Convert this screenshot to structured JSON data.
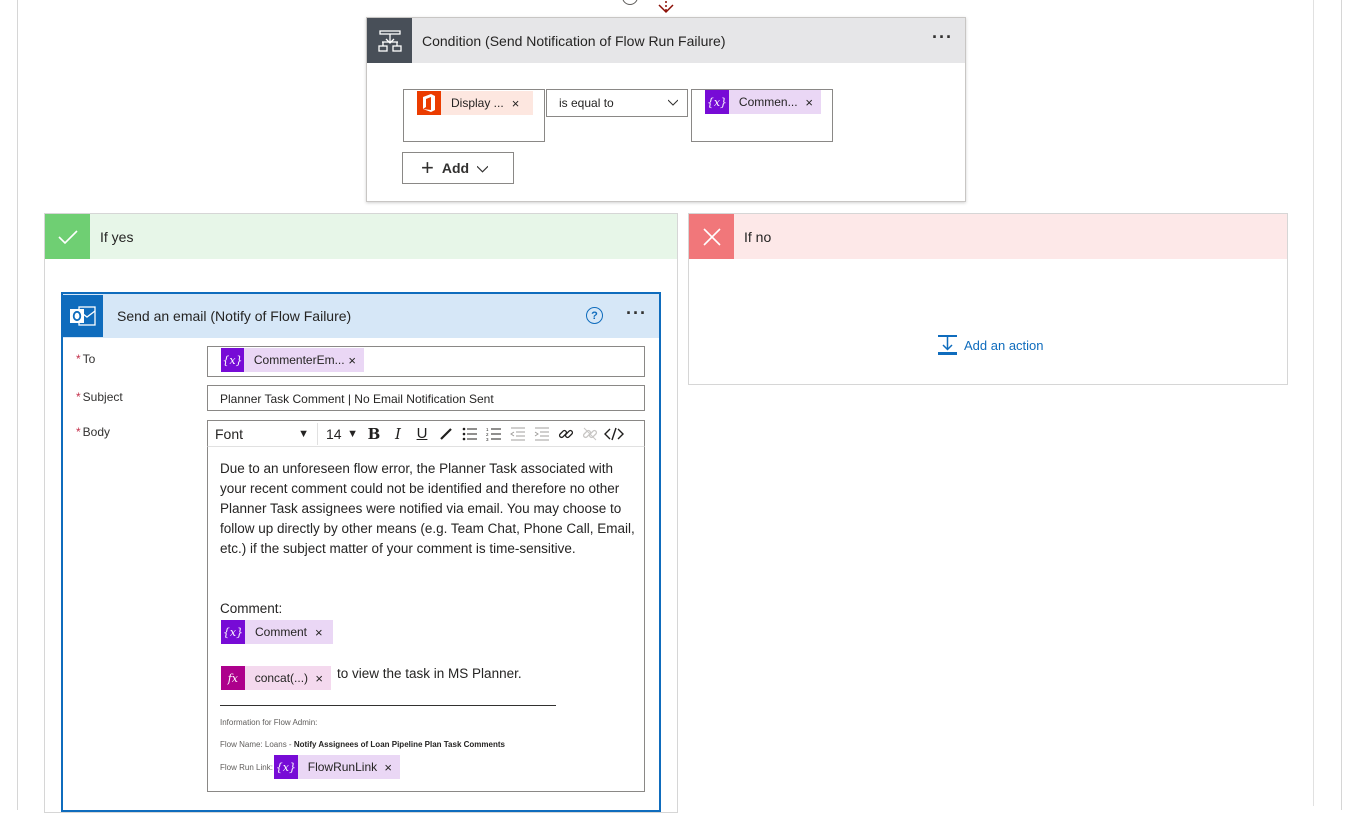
{
  "condition": {
    "title": "Condition (Send Notification of Flow Run Failure)",
    "left_token": "Display ...",
    "operator": "is equal to",
    "right_token": "Commen...",
    "add_label": "Add",
    "token_remove": "×"
  },
  "if_yes": {
    "title": "If yes"
  },
  "if_no": {
    "title": "If no",
    "add_action": "Add an action"
  },
  "email": {
    "title": "Send an email (Notify of Flow Failure)",
    "help": "?",
    "to_label": "To",
    "to_token": "CommenterEm...",
    "subject_label": "Subject",
    "subject_value": "Planner Task Comment | No Email Notification Sent",
    "body_label": "Body",
    "toolbar": {
      "font": "Font",
      "size": "14"
    },
    "body_text": "Due to an unforeseen flow error, the Planner Task associated with your recent comment could not be identified and therefore no other Planner Task assignees were notified via email. You may choose to follow up directly by other means (e.g. Team Chat, Phone Call, Email, etc.) if the subject matter of your comment is time-sensitive.",
    "comment_label": "Comment:",
    "comment_token": "Comment",
    "concat_token": "concat(...)",
    "view_text": "to view the task in MS Planner.",
    "divider_text": "___________________________________________________",
    "admin_info": "Information for Flow Admin:",
    "flow_name_label": "Flow Name: Loans - ",
    "flow_name_value": "Notify Assignees of Loan Pipeline Plan Task Comments",
    "run_link_label": "Flow Run Link: ",
    "run_link_token": "FlowRunLink"
  },
  "colors": {
    "accent": "#0f6cbd",
    "yes_green": "#6fcf73",
    "no_red": "#f1777a",
    "variable_purple": "#770bd6",
    "office_orange": "#eb3c00",
    "expression_magenta": "#ad008c"
  },
  "icons": {
    "condition": "condition-icon",
    "office": "office-icon",
    "variable": "variable-icon",
    "expression": "fx-icon",
    "outlook": "outlook-icon",
    "check": "check-icon",
    "close": "x-icon"
  }
}
